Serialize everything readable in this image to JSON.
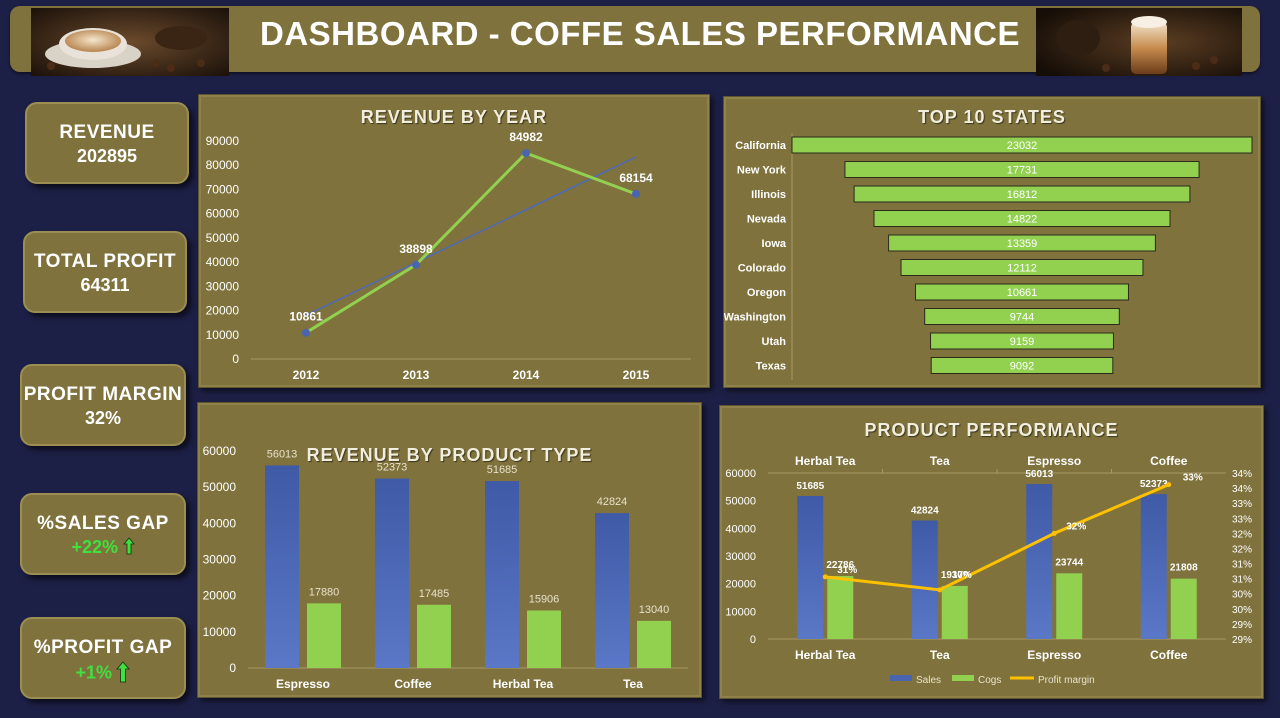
{
  "header": {
    "title": "DASHBOARD - COFFE SALES PERFORMANCE"
  },
  "kpis": {
    "revenue": {
      "label": "REVENUE",
      "value": "202895"
    },
    "profit": {
      "label": "TOTAL PROFIT",
      "value": "64311"
    },
    "margin": {
      "label": "PROFIT MARGIN",
      "value": "32%"
    },
    "sales_gap": {
      "label": "%SALES GAP",
      "value": "+22%"
    },
    "profit_gap": {
      "label": "%PROFIT GAP",
      "value": "+1%"
    }
  },
  "colors": {
    "panel": "#7f723d",
    "background": "#1d2046",
    "green": "#92d050",
    "blue": "#4a65b0",
    "orange": "#ffc000",
    "gap_green": "#40e040"
  },
  "chart_data": [
    {
      "id": "revenue_by_year",
      "type": "line",
      "title": "REVENUE BY YEAR",
      "categories": [
        "2012",
        "2013",
        "2014",
        "2015"
      ],
      "values": [
        10861,
        38898,
        84982,
        68154
      ],
      "trendline": true,
      "ylim": [
        0,
        90000
      ],
      "yticks": [
        0,
        10000,
        20000,
        30000,
        40000,
        50000,
        60000,
        70000,
        80000,
        90000
      ],
      "grid": false
    },
    {
      "id": "top_states",
      "type": "bar",
      "orientation": "horizontal",
      "title": "TOP 10 STATES",
      "categories": [
        "California",
        "New York",
        "Illinois",
        "Nevada",
        "Iowa",
        "Colorado",
        "Oregon",
        "Washington",
        "Utah",
        "Texas"
      ],
      "values": [
        23032,
        17731,
        16812,
        14822,
        13359,
        12112,
        10661,
        9744,
        9159,
        9092
      ]
    },
    {
      "id": "revenue_by_product",
      "type": "bar",
      "title": "REVENUE BY PRODUCT TYPE",
      "categories": [
        "Espresso",
        "Coffee",
        "Herbal Tea",
        "Tea"
      ],
      "series": [
        {
          "values": [
            56013,
            52373,
            51685,
            42824
          ]
        },
        {
          "values": [
            17880,
            17485,
            15906,
            13040
          ]
        }
      ],
      "ylim": [
        0,
        60000
      ],
      "yticks": [
        0,
        10000,
        20000,
        30000,
        40000,
        50000,
        60000
      ]
    },
    {
      "id": "product_performance",
      "type": "bar",
      "title": "PRODUCT PERFORMANCE",
      "categories": [
        "Herbal Tea",
        "Tea",
        "Espresso",
        "Coffee"
      ],
      "series": [
        {
          "name": "Sales",
          "values": [
            51685,
            42824,
            56013,
            52373
          ]
        },
        {
          "name": "Cogs",
          "values": [
            22786,
            19170,
            23744,
            21808
          ]
        },
        {
          "name": "Profit margin",
          "type": "line",
          "axis": "right",
          "values": [
            0.3087,
            0.3048,
            0.3218,
            0.3365
          ],
          "labels": [
            "31%",
            "30%",
            "32%",
            "33%"
          ]
        }
      ],
      "ylim": [
        0,
        60000
      ],
      "yticks": [
        0,
        10000,
        20000,
        30000,
        40000,
        50000,
        60000
      ],
      "y2lim": [
        0.29,
        0.34
      ],
      "y2ticks": [
        "29%",
        "29%",
        "30%",
        "30%",
        "31%",
        "31%",
        "32%",
        "32%",
        "33%",
        "33%",
        "34%",
        "34%"
      ],
      "legend": "bottom"
    }
  ]
}
